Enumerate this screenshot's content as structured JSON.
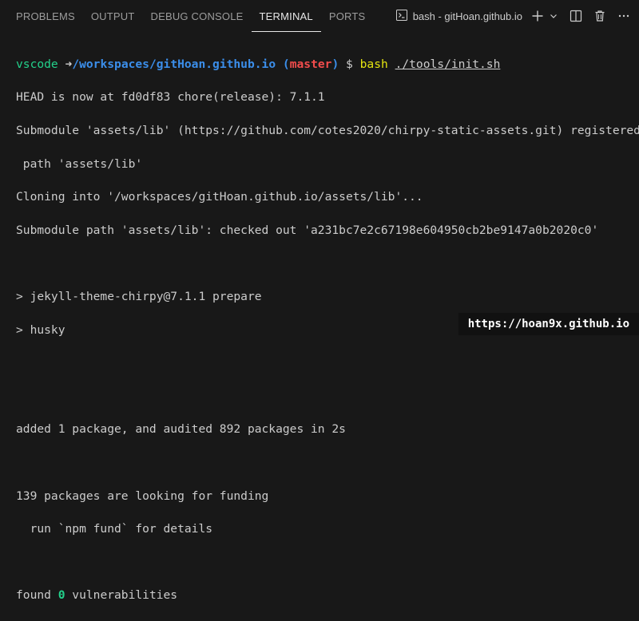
{
  "panel": {
    "tabs": [
      {
        "label": "PROBLEMS"
      },
      {
        "label": "OUTPUT"
      },
      {
        "label": "DEBUG CONSOLE"
      },
      {
        "label": "TERMINAL",
        "active": true
      },
      {
        "label": "PORTS"
      }
    ],
    "terminal_selector": "bash - gitHoan.github.io",
    "icons": [
      "terminal-icon",
      "plus-icon",
      "chevron-down-icon",
      "split-icon",
      "trash-icon",
      "more-icon"
    ]
  },
  "terminal": {
    "prompt_user": "vscode",
    "prompt_arrow": "➜",
    "prompt_path": "/workspaces/gitHoan.github.io",
    "prompt_branch_open": "(",
    "prompt_branch": "master",
    "prompt_branch_close": ")",
    "prompt_dollar": "$",
    "command_bin": "bash",
    "command_arg": "./tools/init.sh",
    "lines": [
      "HEAD is now at fd0df83 chore(release): 7.1.1",
      "Submodule 'assets/lib' (https://github.com/cotes2020/chirpy-static-assets.git) registered for",
      " path 'assets/lib'",
      "Cloning into '/workspaces/gitHoan.github.io/assets/lib'...",
      "Submodule path 'assets/lib': checked out 'a231bc7e2c67198e604950cb2be9147a0b2020c0'",
      "",
      "> jekyll-theme-chirpy@7.1.1 prepare",
      "> husky",
      "",
      "",
      "added 1 package, and audited 892 packages in 2s",
      "",
      "139 packages are looking for funding",
      "  run `npm fund` for details",
      ""
    ],
    "found_prefix": "found ",
    "found_count": "0",
    "found_suffix": " vulnerabilities"
  },
  "watermark": "https://hoan9x.github.io",
  "colors": {
    "background": "#181818",
    "prompt_user": "#23d18b",
    "prompt_path": "#3b8eea",
    "branch": "#f14c4c",
    "command": "#e5e510"
  }
}
